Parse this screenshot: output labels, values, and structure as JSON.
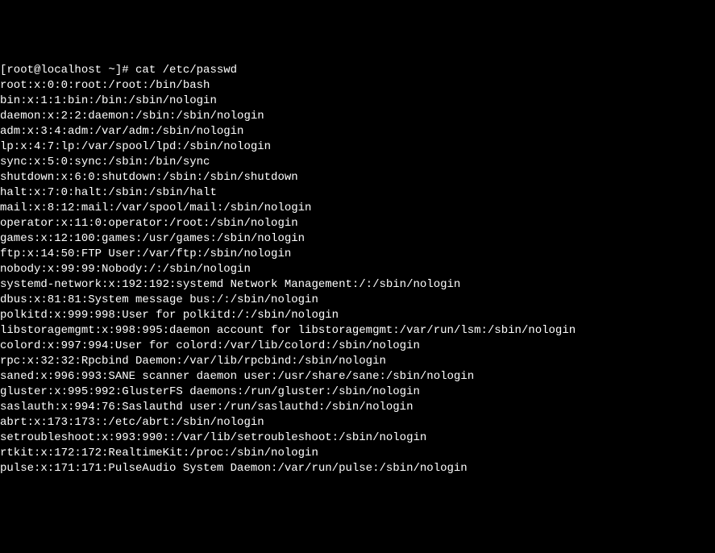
{
  "terminal": {
    "prompt": "[root@localhost ~]# ",
    "command": "cat /etc/passwd",
    "lines": [
      "root:x:0:0:root:/root:/bin/bash",
      "bin:x:1:1:bin:/bin:/sbin/nologin",
      "daemon:x:2:2:daemon:/sbin:/sbin/nologin",
      "adm:x:3:4:adm:/var/adm:/sbin/nologin",
      "lp:x:4:7:lp:/var/spool/lpd:/sbin/nologin",
      "sync:x:5:0:sync:/sbin:/bin/sync",
      "shutdown:x:6:0:shutdown:/sbin:/sbin/shutdown",
      "halt:x:7:0:halt:/sbin:/sbin/halt",
      "mail:x:8:12:mail:/var/spool/mail:/sbin/nologin",
      "operator:x:11:0:operator:/root:/sbin/nologin",
      "games:x:12:100:games:/usr/games:/sbin/nologin",
      "ftp:x:14:50:FTP User:/var/ftp:/sbin/nologin",
      "nobody:x:99:99:Nobody:/:/sbin/nologin",
      "systemd-network:x:192:192:systemd Network Management:/:/sbin/nologin",
      "dbus:x:81:81:System message bus:/:/sbin/nologin",
      "polkitd:x:999:998:User for polkitd:/:/sbin/nologin",
      "libstoragemgmt:x:998:995:daemon account for libstoragemgmt:/var/run/lsm:/sbin/nologin",
      "colord:x:997:994:User for colord:/var/lib/colord:/sbin/nologin",
      "rpc:x:32:32:Rpcbind Daemon:/var/lib/rpcbind:/sbin/nologin",
      "saned:x:996:993:SANE scanner daemon user:/usr/share/sane:/sbin/nologin",
      "gluster:x:995:992:GlusterFS daemons:/run/gluster:/sbin/nologin",
      "saslauth:x:994:76:Saslauthd user:/run/saslauthd:/sbin/nologin",
      "abrt:x:173:173::/etc/abrt:/sbin/nologin",
      "setroubleshoot:x:993:990::/var/lib/setroubleshoot:/sbin/nologin",
      "rtkit:x:172:172:RealtimeKit:/proc:/sbin/nologin",
      "pulse:x:171:171:PulseAudio System Daemon:/var/run/pulse:/sbin/nologin"
    ]
  }
}
